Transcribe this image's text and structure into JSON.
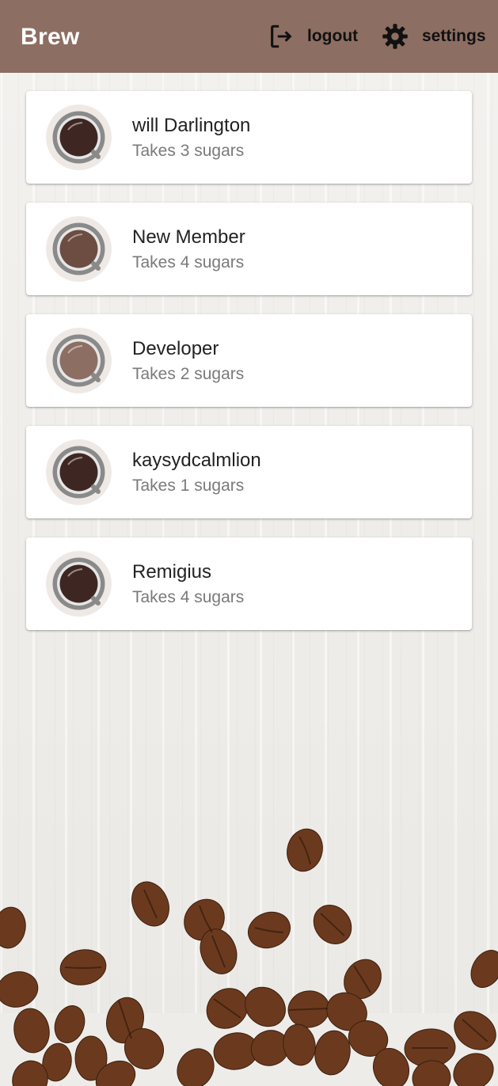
{
  "appbar": {
    "title": "Brew",
    "logout_label": "logout",
    "settings_label": "settings",
    "color": "#8d6e63"
  },
  "members": [
    {
      "name": "will Darlington",
      "subtitle": "Takes 3 sugars",
      "coffee_color": "#3e2723"
    },
    {
      "name": "New Member",
      "subtitle": "Takes 4 sugars",
      "coffee_color": "#6d4c41"
    },
    {
      "name": "Developer",
      "subtitle": "Takes 2 sugars",
      "coffee_color": "#8d6e63"
    },
    {
      "name": "kaysydcalmlion",
      "subtitle": "Takes 1 sugars",
      "coffee_color": "#3e2723"
    },
    {
      "name": "Remigius",
      "subtitle": "Takes 4 sugars",
      "coffee_color": "#3e2723"
    }
  ],
  "icons": {
    "logout": "logout-icon",
    "settings": "gear-icon",
    "avatar": "coffee-cup-icon"
  }
}
